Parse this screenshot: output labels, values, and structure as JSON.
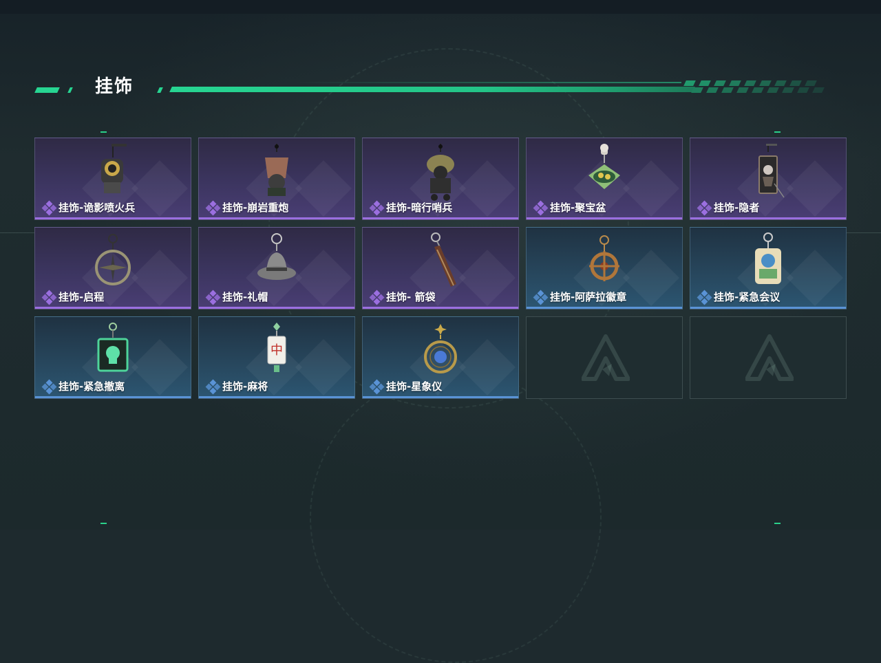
{
  "page": {
    "section_title": "挂饰"
  },
  "colors": {
    "accent_green": "#27d592",
    "rarity_purple": "#9b6fe0",
    "rarity_blue": "#5a93d6"
  },
  "items": [
    {
      "label": "挂饰-诡影喷火兵",
      "rarity": "purple",
      "icon": "flamethrower-soldier-charm-icon"
    },
    {
      "label": "挂饰-崩岩重炮",
      "rarity": "purple",
      "icon": "heavy-gunner-charm-icon"
    },
    {
      "label": "挂饰-暗行哨兵",
      "rarity": "purple",
      "icon": "sentinel-charm-icon"
    },
    {
      "label": "挂饰-聚宝盆",
      "rarity": "purple",
      "icon": "treasure-bowl-charm-icon"
    },
    {
      "label": "挂饰-隐者",
      "rarity": "purple",
      "icon": "hermit-card-charm-icon"
    },
    {
      "label": "挂饰-启程",
      "rarity": "purple",
      "icon": "compass-ring-charm-icon"
    },
    {
      "label": "挂饰-礼帽",
      "rarity": "purple",
      "icon": "fedora-hat-charm-icon"
    },
    {
      "label": "挂饰- 箭袋",
      "rarity": "purple",
      "icon": "quiver-charm-icon"
    },
    {
      "label": "挂饰-阿萨拉徽章",
      "rarity": "blue",
      "icon": "ship-wheel-badge-charm-icon"
    },
    {
      "label": "挂饰-紧急会议",
      "rarity": "blue",
      "icon": "meeting-badge-charm-icon"
    },
    {
      "label": "挂饰-紧急撤离",
      "rarity": "blue",
      "icon": "evacuation-skull-charm-icon"
    },
    {
      "label": "挂饰-麻将",
      "rarity": "blue",
      "icon": "mahjong-tile-charm-icon"
    },
    {
      "label": "挂饰-星象仪",
      "rarity": "blue",
      "icon": "astrolabe-charm-icon"
    },
    {
      "label": "",
      "rarity": "empty",
      "icon": "empty-slot-logo-icon"
    },
    {
      "label": "",
      "rarity": "empty",
      "icon": "empty-slot-logo-icon"
    }
  ]
}
